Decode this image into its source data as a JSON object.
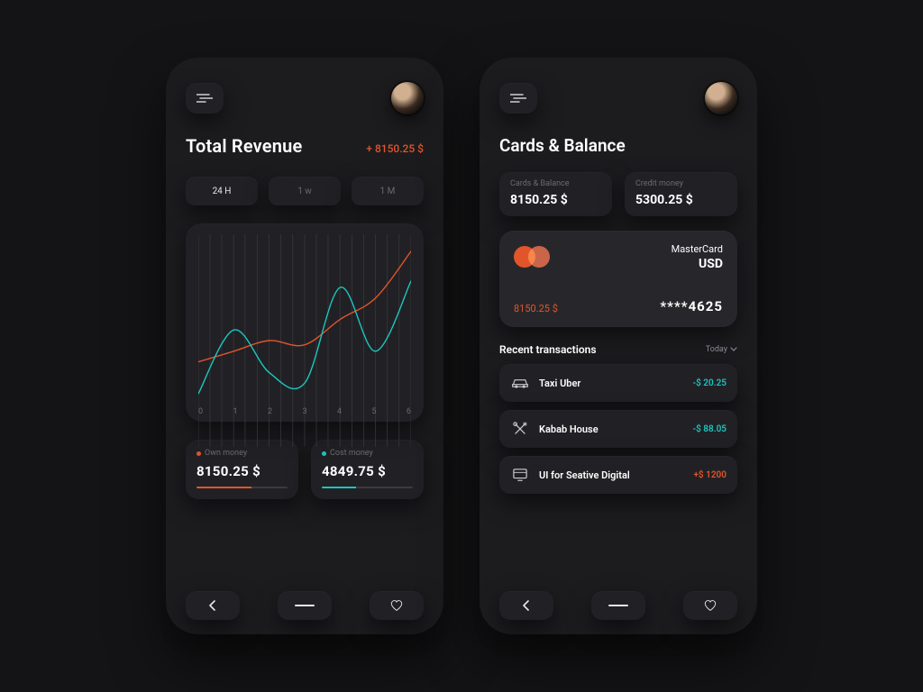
{
  "chart_data": {
    "type": "line",
    "x": [
      0,
      1,
      2,
      3,
      4,
      5,
      6
    ],
    "series": [
      {
        "name": "Own money",
        "color": "#e2552b",
        "values": [
          40,
          45,
          50,
          48,
          60,
          70,
          92
        ]
      },
      {
        "name": "Cost money",
        "color": "#1cc6bf",
        "values": [
          25,
          55,
          35,
          30,
          75,
          45,
          78
        ]
      }
    ],
    "xlabel": "",
    "ylabel": "",
    "ylim": [
      0,
      100
    ],
    "xticks": [
      "0",
      "1",
      "2",
      "3",
      "4",
      "5",
      "6"
    ]
  },
  "revenue": {
    "title": "Total Revenue",
    "delta": "+ 8150.25 $",
    "range": {
      "h24": "24 H",
      "w1": "1 w",
      "m1": "1 M"
    },
    "tiles": {
      "own": {
        "label": "Own money",
        "value": "8150.25 $",
        "progress_pct": 60
      },
      "cost": {
        "label": "Cost money",
        "value": "4849.75 $",
        "progress_pct": 38
      }
    }
  },
  "balance": {
    "title": "Cards & Balance",
    "cards_balance": {
      "label": "Cards & Balance",
      "value": "8150.25 $"
    },
    "credit_money": {
      "label": "Credit money",
      "value": "5300.25 $"
    },
    "card": {
      "brand": "MasterCard",
      "currency": "USD",
      "amount": "8150.25 $",
      "number": "****4625"
    },
    "recent": {
      "header": "Recent transactions",
      "filter": "Today"
    },
    "transactions": [
      {
        "icon": "car-icon",
        "name": "Taxi Uber",
        "amount": "-$ 20.25",
        "tone": "green"
      },
      {
        "icon": "food-icon",
        "name": "Kabab House",
        "amount": "-$ 88.05",
        "tone": "green"
      },
      {
        "icon": "design-icon",
        "name": "UI  for Seative Digital",
        "amount": "+$ 1200",
        "tone": "orange"
      }
    ]
  }
}
